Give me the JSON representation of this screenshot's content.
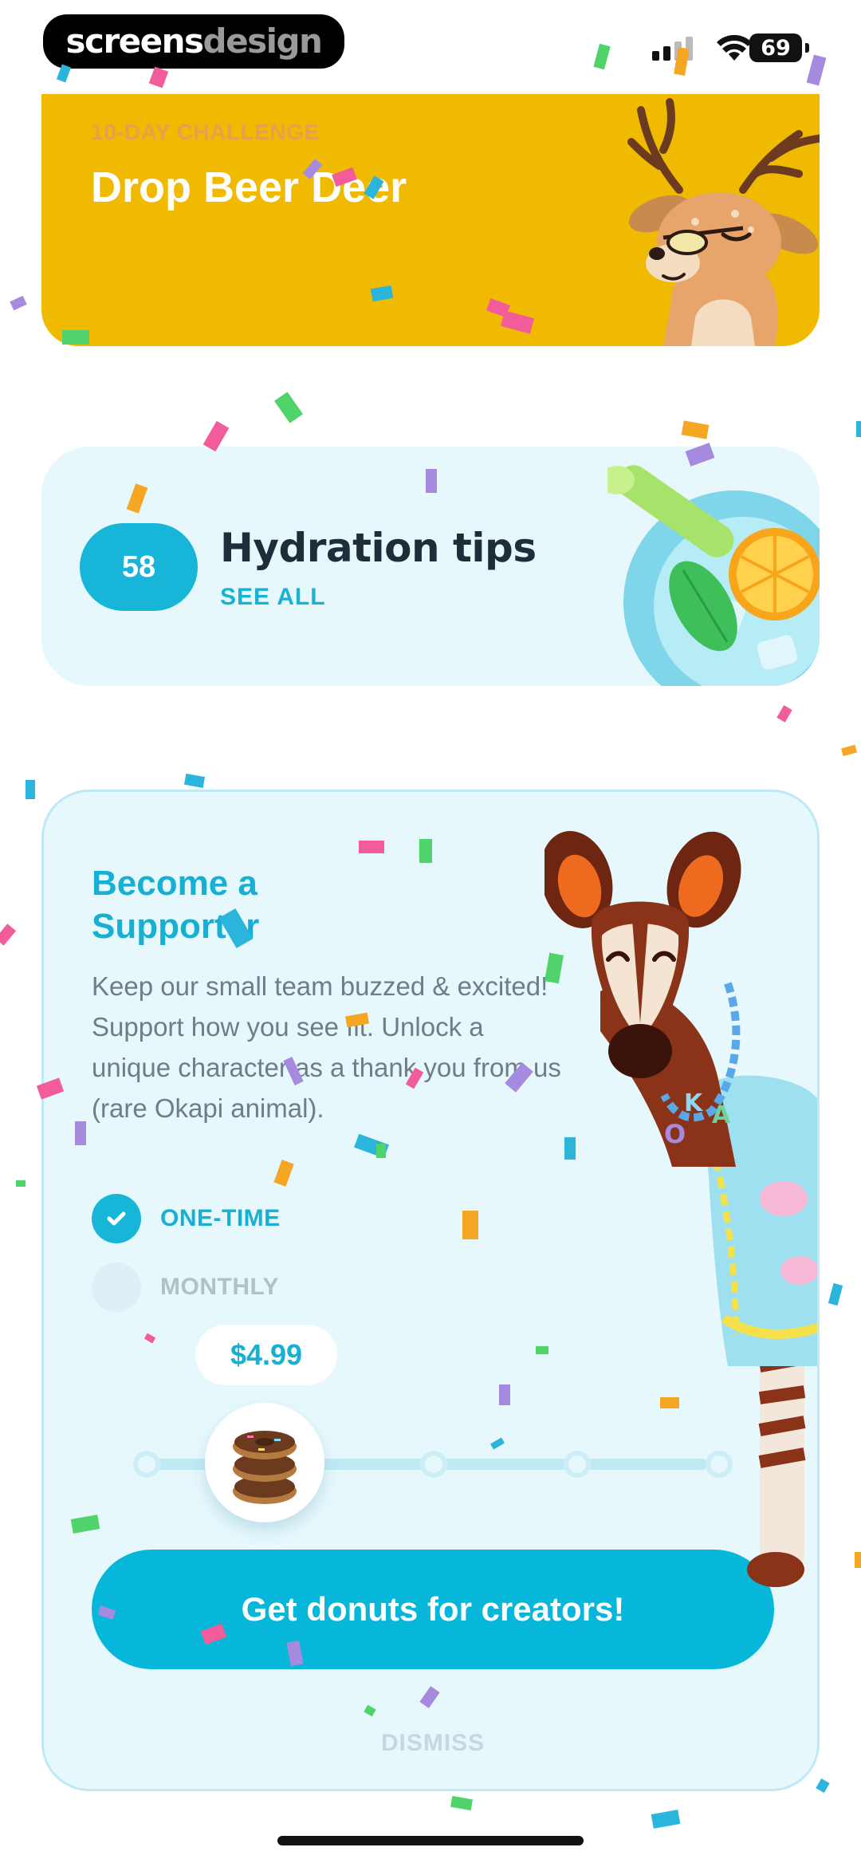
{
  "watermark": {
    "part1": "screens",
    "part2": "design"
  },
  "status_bar": {
    "battery": "69"
  },
  "challenge": {
    "kicker": "10-DAY CHALLENGE",
    "title": "Drop Beer Deer"
  },
  "hydration": {
    "count": "58",
    "title": "Hydration tips",
    "link": "SEE ALL"
  },
  "supporter": {
    "title": "Become a Supporter",
    "body": "Keep our small team buzzed & excited! Support how you see fit. Unlock a unique character as a thank you from us (rare Okapi animal).",
    "options": [
      {
        "label": "ONE-TIME",
        "selected": true
      },
      {
        "label": "MONTHLY",
        "selected": false
      }
    ],
    "price": "$4.99",
    "slider": {
      "stops": 5,
      "selected_index": 1
    },
    "cta": "Get donuts for creators!",
    "dismiss": "DISMISS"
  },
  "colors": {
    "accent": "#17b6d9",
    "challenge_bg": "#efba00",
    "card_bg": "#e6f8fc"
  }
}
